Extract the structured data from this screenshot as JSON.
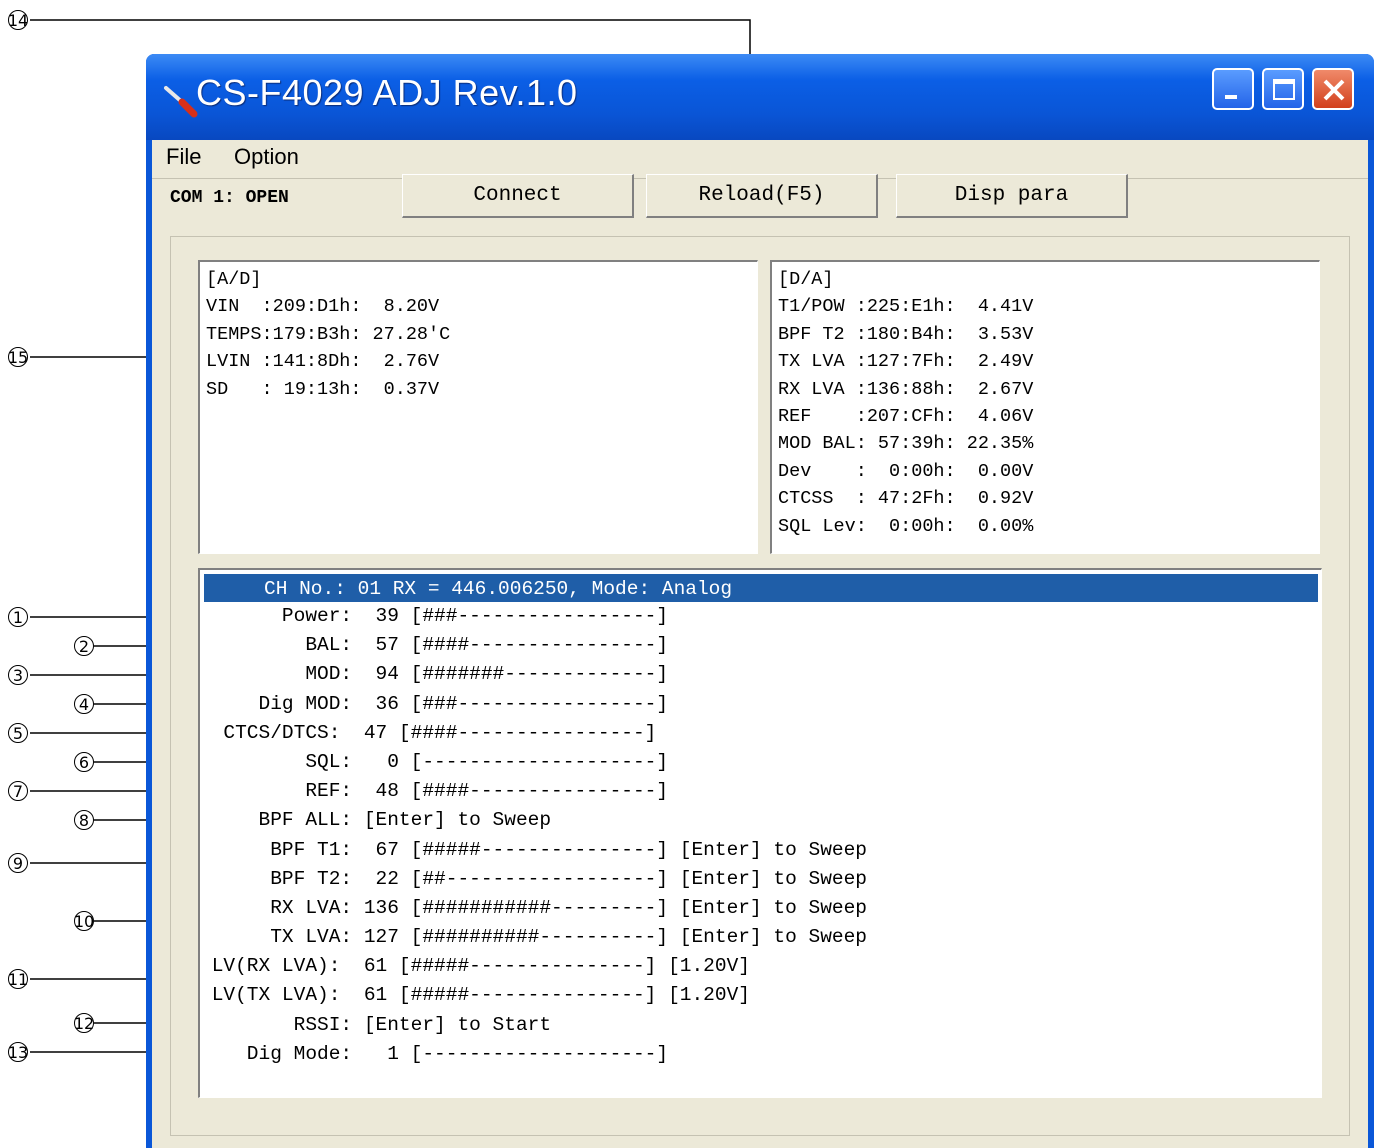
{
  "window": {
    "title": "CS-F4029 ADJ Rev.1.0",
    "controls": [
      "minimize-icon",
      "maximize-icon",
      "close-icon"
    ]
  },
  "menu": {
    "items": [
      "File",
      "Option"
    ]
  },
  "toolbar": {
    "com_status": "COM 1: OPEN",
    "buttons": [
      "Connect",
      "Reload(F5)",
      "Disp para"
    ]
  },
  "ad_panel": {
    "lines": [
      "[A/D]",
      "VIN  :209:D1h:  8.20V",
      "TEMPS:179:B3h: 27.28'C",
      "LVIN :141:8Dh:  2.76V",
      "SD   : 19:13h:  0.37V"
    ]
  },
  "da_panel": {
    "lines": [
      "[D/A]",
      "T1/POW :225:E1h:  4.41V",
      "BPF T2 :180:B4h:  3.53V",
      "TX LVA :127:7Fh:  2.49V",
      "RX LVA :136:88h:  2.67V",
      "REF    :207:CFh:  4.06V",
      "MOD BAL: 57:39h: 22.35%",
      "Dev    :  0:00h:  0.00V",
      "CTCSS  : 47:2Fh:  0.92V",
      "SQL Lev:  0:00h:  0.00%"
    ]
  },
  "adjust_panel": {
    "header": "CH No.: 01 RX = 446.006250, Mode: Analog",
    "lines": [
      "       Power:  39 [###-----------------]",
      "         BAL:  57 [####----------------]",
      "         MOD:  94 [#######-------------]",
      "     Dig MOD:  36 [###-----------------]",
      "  CTCS/DTCS:  47 [####----------------]",
      "         SQL:   0 [--------------------]",
      "         REF:  48 [####----------------]",
      "     BPF ALL: [Enter] to Sweep",
      "      BPF T1:  67 [#####---------------] [Enter] to Sweep",
      "      BPF T2:  22 [##------------------] [Enter] to Sweep",
      "      RX LVA: 136 [###########---------] [Enter] to Sweep",
      "      TX LVA: 127 [##########----------] [Enter] to Sweep",
      " LV(RX LVA):  61 [#####---------------] [1.20V]",
      " LV(TX LVA):  61 [#####---------------] [1.20V]",
      "        RSSI: [Enter] to Start",
      "    Dig Mode:   1 [--------------------]"
    ]
  },
  "callouts": [
    "1",
    "2",
    "3",
    "4",
    "5",
    "6",
    "7",
    "8",
    "9",
    "10",
    "11",
    "12",
    "13",
    "14",
    "15"
  ]
}
